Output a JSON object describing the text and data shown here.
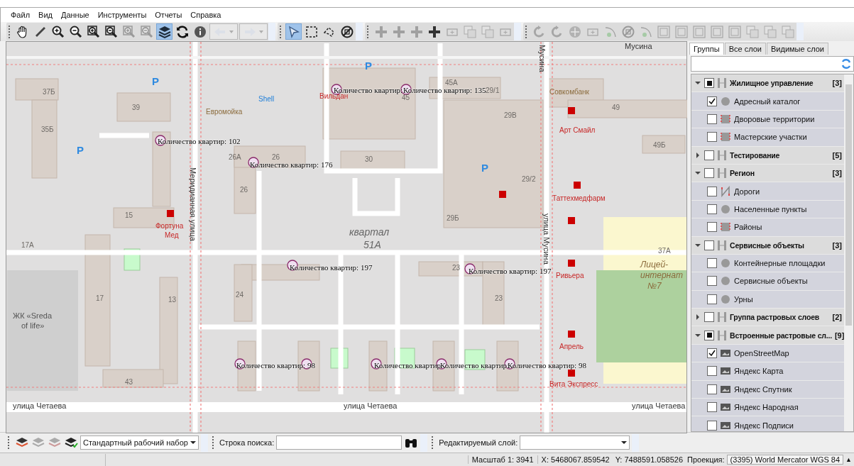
{
  "menu": [
    "Файл",
    "Вид",
    "Данные",
    "Инструменты",
    "Отчеты",
    "Справка"
  ],
  "toolbar": [
    [
      {
        "kind": "pan",
        "disabled": false,
        "selected": false
      },
      {
        "kind": "measure",
        "disabled": false,
        "selected": false
      },
      {
        "kind": "zoom-in",
        "disabled": false,
        "selected": false
      },
      {
        "kind": "zoom-out",
        "disabled": false,
        "selected": false
      },
      {
        "kind": "zoom-in-box",
        "disabled": false,
        "selected": false
      },
      {
        "kind": "zoom-out-box",
        "disabled": false,
        "selected": false
      },
      {
        "kind": "zoom-in-box",
        "disabled": true,
        "selected": false
      },
      {
        "kind": "zoom-out-box",
        "disabled": true,
        "selected": false
      },
      {
        "kind": "layers",
        "disabled": false,
        "selected": true
      },
      {
        "kind": "refresh",
        "disabled": false,
        "selected": false
      },
      {
        "kind": "info",
        "disabled": false,
        "selected": false
      },
      {
        "kind": "back",
        "disabled": true,
        "selected": false
      },
      {
        "kind": "forward",
        "disabled": true,
        "selected": false
      }
    ],
    [
      {
        "kind": "select-arrow",
        "disabled": false,
        "selected": true
      },
      {
        "kind": "select-rect",
        "disabled": false,
        "selected": false
      },
      {
        "kind": "select-polygon",
        "disabled": false,
        "selected": false
      },
      {
        "kind": "clear-selection",
        "disabled": false,
        "selected": false
      }
    ],
    [
      {
        "kind": "plus",
        "disabled": true,
        "selected": false
      },
      {
        "kind": "plus",
        "disabled": true,
        "selected": false
      },
      {
        "kind": "plus",
        "disabled": true,
        "selected": false
      },
      {
        "kind": "plus",
        "disabled": false,
        "selected": false
      },
      {
        "kind": "rect",
        "disabled": true,
        "selected": false
      },
      {
        "kind": "copy",
        "disabled": true,
        "selected": false
      },
      {
        "kind": "copy",
        "disabled": true,
        "selected": false
      },
      {
        "kind": "rect",
        "disabled": true,
        "selected": false
      }
    ],
    [
      {
        "kind": "undo",
        "disabled": true,
        "selected": false
      },
      {
        "kind": "undo",
        "disabled": true,
        "selected": false
      },
      {
        "kind": "move",
        "disabled": true,
        "selected": false
      },
      {
        "kind": "rect",
        "disabled": true,
        "selected": false
      },
      {
        "kind": "arc",
        "disabled": true,
        "selected": false
      },
      {
        "kind": "clear-selection",
        "disabled": true,
        "selected": false
      },
      {
        "kind": "arc",
        "disabled": true,
        "selected": false
      },
      {
        "kind": "frame",
        "disabled": true,
        "selected": false
      },
      {
        "kind": "frame",
        "disabled": true,
        "selected": false
      },
      {
        "kind": "frame",
        "disabled": true,
        "selected": false
      },
      {
        "kind": "frame",
        "disabled": true,
        "selected": false
      },
      {
        "kind": "frame",
        "disabled": true,
        "selected": false
      },
      {
        "kind": "copy",
        "disabled": true,
        "selected": false
      },
      {
        "kind": "copy",
        "disabled": true,
        "selected": false
      },
      {
        "kind": "copy",
        "disabled": true,
        "selected": false
      }
    ]
  ],
  "map_labels": [
    {
      "kind": "street",
      "text": "Мусина"
    },
    {
      "kind": "street-vertical",
      "text": "Мусина"
    },
    {
      "kind": "parking",
      "text": "P"
    },
    {
      "kind": "parking",
      "text": "P"
    },
    {
      "kind": "house",
      "text": "45А"
    },
    {
      "kind": "house",
      "text": "37Б"
    },
    {
      "kind": "count",
      "text": "Количество квартир:"
    },
    {
      "kind": "count",
      "text": "Количество квартир: 135"
    },
    {
      "kind": "house",
      "text": "29/1"
    },
    {
      "kind": "poi-brown",
      "text": "Совкомбанк"
    },
    {
      "kind": "poi-blue",
      "text": "Shell"
    },
    {
      "kind": "poi-red",
      "text": "Вильдан"
    },
    {
      "kind": "house",
      "text": "45"
    },
    {
      "kind": "house",
      "text": "39"
    },
    {
      "kind": "poi-brown",
      "text": "Евромойка"
    },
    {
      "kind": "house",
      "text": "29В"
    },
    {
      "kind": "house",
      "text": "49"
    },
    {
      "kind": "house",
      "text": "35Б"
    },
    {
      "kind": "poi-red",
      "text": "Арт Смайл"
    },
    {
      "kind": "parking",
      "text": "P"
    },
    {
      "kind": "count",
      "text": "Количество квартир: 102"
    },
    {
      "kind": "house",
      "text": "49Б"
    },
    {
      "kind": "house",
      "text": "26А"
    },
    {
      "kind": "count",
      "text": "Количество квартир: 176"
    },
    {
      "kind": "house",
      "text": "26"
    },
    {
      "kind": "house",
      "text": "30"
    },
    {
      "kind": "parking",
      "text": "P"
    },
    {
      "kind": "street-vertical",
      "text": "Меридианная улица"
    },
    {
      "kind": "house",
      "text": "29/2"
    },
    {
      "kind": "house",
      "text": "26"
    },
    {
      "kind": "poi-red",
      "text": "Таттехмедфарм"
    },
    {
      "kind": "house",
      "text": "15"
    },
    {
      "kind": "house",
      "text": "29Б"
    },
    {
      "kind": "street-vertical",
      "text": "улица Мусина"
    },
    {
      "kind": "poi-red",
      "text": "Фортуна"
    },
    {
      "kind": "district",
      "text": "квартал"
    },
    {
      "kind": "poi-red",
      "text": "Мед"
    },
    {
      "kind": "house",
      "text": "17А"
    },
    {
      "kind": "district",
      "text": "51А"
    },
    {
      "kind": "house",
      "text": "37А"
    },
    {
      "kind": "count",
      "text": "Количество квартир: 197"
    },
    {
      "kind": "house",
      "text": "23"
    },
    {
      "kind": "count",
      "text": "Количество квартир: 197"
    },
    {
      "kind": "school",
      "text": "Лицей-"
    },
    {
      "kind": "poi-red",
      "text": "Ривьера"
    },
    {
      "kind": "school",
      "text": "интернат"
    },
    {
      "kind": "school",
      "text": "№7"
    },
    {
      "kind": "house",
      "text": "17"
    },
    {
      "kind": "house",
      "text": "13"
    },
    {
      "kind": "house",
      "text": "24"
    },
    {
      "kind": "house",
      "text": "23"
    },
    {
      "kind": "area",
      "text": "ЖК «Sreda"
    },
    {
      "kind": "area",
      "text": "of life»"
    },
    {
      "kind": "poi-red",
      "text": "Апрель"
    },
    {
      "kind": "count",
      "text": "Количество квартир: 98"
    },
    {
      "kind": "count",
      "text": "Количество квартир"
    },
    {
      "kind": "count",
      "text": "Количество квартир:"
    },
    {
      "kind": "count",
      "text": "Количество квартир: 98"
    },
    {
      "kind": "house",
      "text": "43"
    },
    {
      "kind": "poi-red",
      "text": "Вита Экспресс"
    },
    {
      "kind": "street",
      "text": "улица Четаева"
    },
    {
      "kind": "street",
      "text": "улица Четаева"
    },
    {
      "kind": "street",
      "text": "улица Четаева"
    }
  ],
  "panel": {
    "tabs": [
      {
        "label": "Группы",
        "selected": true
      },
      {
        "label": "Все слои",
        "selected": false
      },
      {
        "label": "Видимые слои",
        "selected": false
      }
    ],
    "groups": [
      {
        "name": "Жилищное управление",
        "count": "[3]",
        "expanded": true,
        "partial": true,
        "children": [
          {
            "name": "Адресный каталог",
            "kind": "point",
            "checked": true
          },
          {
            "name": "Дворовые территории",
            "kind": "polygon",
            "checked": false
          },
          {
            "name": "Мастерские участки",
            "kind": "polygon",
            "checked": false
          }
        ]
      },
      {
        "name": "Тестирование",
        "count": "[5]",
        "expanded": false,
        "partial": false
      },
      {
        "name": "Регион",
        "count": "[3]",
        "expanded": true,
        "partial": false,
        "children": [
          {
            "name": "Дороги",
            "kind": "line",
            "checked": false
          },
          {
            "name": "Населенные пункты",
            "kind": "point",
            "checked": false
          },
          {
            "name": "Районы",
            "kind": "polygon",
            "checked": false
          }
        ]
      },
      {
        "name": "Сервисные объекты",
        "count": "[3]",
        "expanded": true,
        "partial": false,
        "children": [
          {
            "name": "Контейнерные площадки",
            "kind": "point",
            "checked": false
          },
          {
            "name": "Сервисные объекты",
            "kind": "point",
            "checked": false
          },
          {
            "name": "Урны",
            "kind": "point",
            "checked": false
          }
        ]
      },
      {
        "name": "Группа растровых слоев",
        "count": "[2]",
        "expanded": false,
        "partial": false
      },
      {
        "name": "Встроенные растровые сл...",
        "count": "[9]",
        "expanded": true,
        "partial": true,
        "children": [
          {
            "name": "OpenStreetMap",
            "kind": "raster",
            "checked": true
          },
          {
            "name": "Яндекс Карта",
            "kind": "raster",
            "checked": false
          },
          {
            "name": "Яндекс Спутник",
            "kind": "raster",
            "checked": false
          },
          {
            "name": "Яндекс Народная",
            "kind": "raster",
            "checked": false
          },
          {
            "name": "Яндекс Подписи",
            "kind": "raster",
            "checked": false
          }
        ]
      }
    ]
  },
  "bottom_bar": {
    "workset": "Стандартный рабочий набор",
    "search_label": "Строка поиска:",
    "layer_label": "Редактируемый слой:"
  },
  "status_bar": {
    "scale": "Масштаб 1: 3941",
    "x": "X: 5468067.859542",
    "y": "Y: 7488591.058526",
    "projection_label": "Проекция:",
    "projection": "(3395) World Mercator WGS 84",
    "projection_arrow": "▲"
  }
}
